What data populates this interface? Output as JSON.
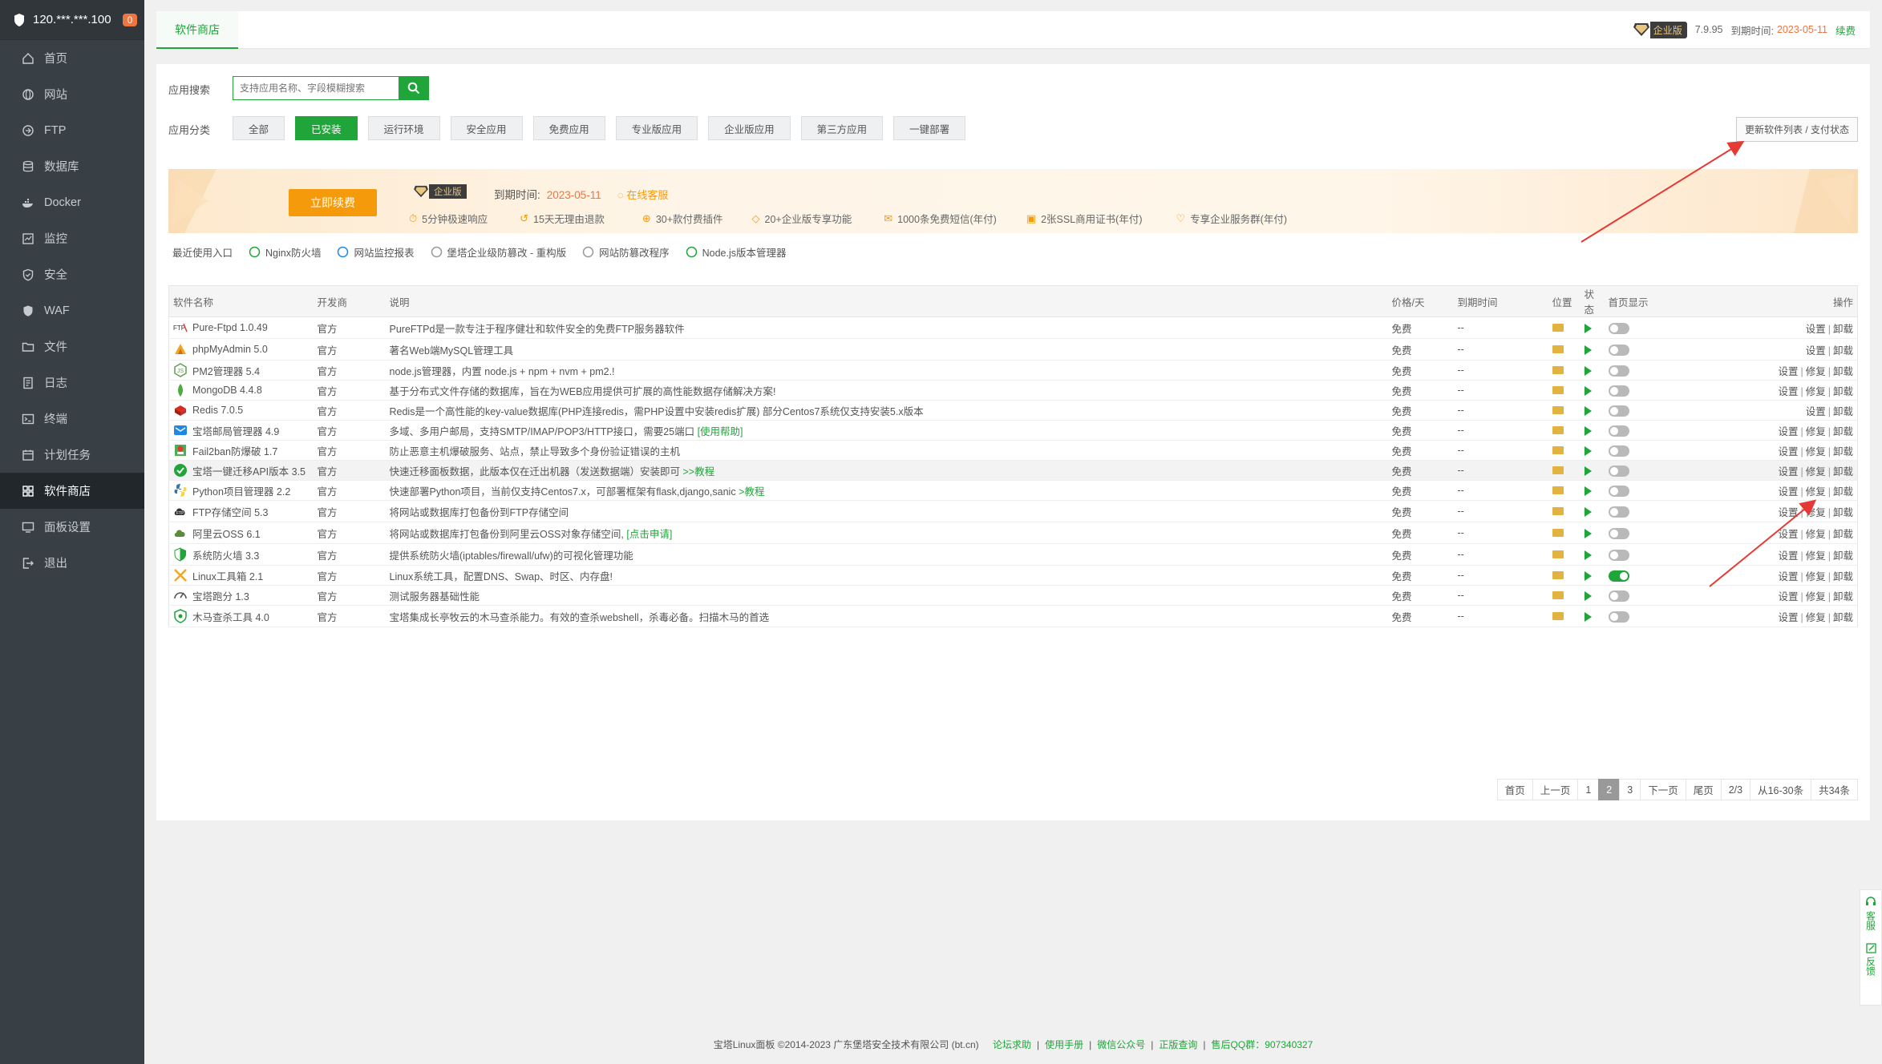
{
  "sidebar": {
    "server_ip": "120.***.***.100",
    "badge_count": "0",
    "items": [
      {
        "label": "首页",
        "icon": "home-icon"
      },
      {
        "label": "网站",
        "icon": "globe-icon"
      },
      {
        "label": "FTP",
        "icon": "ftp-icon"
      },
      {
        "label": "数据库",
        "icon": "database-icon"
      },
      {
        "label": "Docker",
        "icon": "docker-icon"
      },
      {
        "label": "监控",
        "icon": "monitor-icon"
      },
      {
        "label": "安全",
        "icon": "shield-icon"
      },
      {
        "label": "WAF",
        "icon": "waf-icon"
      },
      {
        "label": "文件",
        "icon": "folder-icon"
      },
      {
        "label": "日志",
        "icon": "log-icon"
      },
      {
        "label": "终端",
        "icon": "terminal-icon"
      },
      {
        "label": "计划任务",
        "icon": "calendar-icon"
      },
      {
        "label": "软件商店",
        "icon": "grid-icon",
        "active": true
      },
      {
        "label": "面板设置",
        "icon": "settings-icon"
      },
      {
        "label": "退出",
        "icon": "logout-icon"
      }
    ]
  },
  "topbar": {
    "tab": "软件商店",
    "edition": "企业版",
    "version": "7.9.95",
    "expire_label": "到期时间:",
    "expire_date": "2023-05-11",
    "renew": "续费"
  },
  "search": {
    "label": "应用搜索",
    "placeholder": "支持应用名称、字段模糊搜索"
  },
  "categories": {
    "label": "应用分类",
    "items": [
      "全部",
      "已安装",
      "运行环境",
      "安全应用",
      "免费应用",
      "专业版应用",
      "企业版应用",
      "第三方应用",
      "一键部署"
    ],
    "active_index": 1
  },
  "update_button": "更新软件列表 / 支付状态",
  "banner": {
    "buy_button": "立即续费",
    "edition": "企业版",
    "expire_label": "到期时间:",
    "expire_date": "2023-05-11",
    "online_service": "在线客服",
    "perks": [
      "5分钟极速响应",
      "15天无理由退款",
      "30+款付费插件",
      "20+企业版专享功能",
      "1000条免费短信(年付)",
      "2张SSL商用证书(年付)",
      "专享企业服务群(年付)"
    ]
  },
  "recent": {
    "label": "最近使用入口",
    "items": [
      "Nginx防火墙",
      "网站监控报表",
      "堡塔企业级防篡改 - 重构版",
      "网站防篡改程序",
      "Node.js版本管理器"
    ]
  },
  "table": {
    "headers": [
      "软件名称",
      "开发商",
      "说明",
      "价格/天",
      "到期时间",
      "位置",
      "状态",
      "首页显示",
      "操作"
    ],
    "rows": [
      {
        "name": "Pure-Ftpd 1.0.49",
        "icon": "ftp-logo-icon",
        "dev": "官方",
        "desc": "PureFTPd是一款专注于程序健壮和软件安全的免费FTP服务器软件",
        "price": "免费",
        "expire": "--",
        "home": false,
        "ops": [
          "设置",
          "卸载"
        ]
      },
      {
        "name": "phpMyAdmin 5.0",
        "icon": "phpmyadmin-icon",
        "dev": "官方",
        "desc": "著名Web端MySQL管理工具",
        "price": "免费",
        "expire": "--",
        "home": false,
        "ops": [
          "设置",
          "卸载"
        ]
      },
      {
        "name": "PM2管理器 5.4",
        "icon": "nodejs-icon",
        "dev": "官方",
        "desc": "node.js管理器，内置 node.js + npm + nvm + pm2.!",
        "price": "免费",
        "expire": "--",
        "home": false,
        "ops": [
          "设置",
          "修复",
          "卸载"
        ]
      },
      {
        "name": "MongoDB 4.4.8",
        "icon": "mongodb-icon",
        "dev": "官方",
        "desc": "基于分布式文件存储的数据库，旨在为WEB应用提供可扩展的高性能数据存储解决方案!",
        "price": "免费",
        "expire": "--",
        "home": false,
        "ops": [
          "设置",
          "修复",
          "卸载"
        ]
      },
      {
        "name": "Redis 7.0.5",
        "icon": "redis-icon",
        "dev": "官方",
        "desc": "Redis是一个高性能的key-value数据库(PHP连接redis，需PHP设置中安装redis扩展) 部分Centos7系统仅支持安装5.x版本",
        "price": "免费",
        "expire": "--",
        "home": false,
        "ops": [
          "设置",
          "卸载"
        ]
      },
      {
        "name": "宝塔邮局管理器 4.9",
        "icon": "mail-icon",
        "dev": "官方",
        "desc": "多域、多用户邮局，支持SMTP/IMAP/POP3/HTTP接口，需要25端口",
        "desc_link": "[使用帮助]",
        "price": "免费",
        "expire": "--",
        "home": false,
        "ops": [
          "设置",
          "修复",
          "卸载"
        ]
      },
      {
        "name": "Fail2ban防爆破 1.7",
        "icon": "fail2ban-icon",
        "dev": "官方",
        "desc": "防止恶意主机爆破服务、站点，禁止导致多个身份验证错误的主机",
        "price": "免费",
        "expire": "--",
        "home": false,
        "ops": [
          "设置",
          "修复",
          "卸载"
        ]
      },
      {
        "name": "宝塔一键迁移API版本 3.5",
        "icon": "check-circle-icon",
        "dev": "官方",
        "desc": "快速迁移面板数据，此版本仅在迁出机器（发送数据端）安装即可",
        "desc_link": ">>教程",
        "price": "免费",
        "expire": "--",
        "home": false,
        "ops": [
          "设置",
          "修复",
          "卸载"
        ],
        "highlight": true
      },
      {
        "name": "Python项目管理器 2.2",
        "icon": "python-icon",
        "dev": "官方",
        "desc": "快速部署Python项目，当前仅支持Centos7.x，可部署框架有flask,django,sanic",
        "desc_link": ">教程",
        "price": "免费",
        "expire": "--",
        "home": false,
        "ops": [
          "设置",
          "修复",
          "卸载"
        ]
      },
      {
        "name": "FTP存储空间 5.3",
        "icon": "ftp-cloud-icon",
        "dev": "官方",
        "desc": "将网站或数据库打包备份到FTP存储空间",
        "price": "免费",
        "expire": "--",
        "home": false,
        "ops": [
          "设置",
          "修复",
          "卸载"
        ]
      },
      {
        "name": "阿里云OSS 6.1",
        "icon": "oss-icon",
        "dev": "官方",
        "desc": "将网站或数据库打包备份到阿里云OSS对象存储空间,",
        "desc_link": "[点击申请]",
        "price": "免费",
        "expire": "--",
        "home": false,
        "ops": [
          "设置",
          "修复",
          "卸载"
        ]
      },
      {
        "name": "系统防火墙 3.3",
        "icon": "firewall-icon",
        "dev": "官方",
        "desc": "提供系统防火墙(iptables/firewall/ufw)的可视化管理功能",
        "price": "免费",
        "expire": "--",
        "home": false,
        "ops": [
          "设置",
          "修复",
          "卸载"
        ]
      },
      {
        "name": "Linux工具箱 2.1",
        "icon": "tools-icon",
        "dev": "官方",
        "desc": "Linux系统工具，配置DNS、Swap、时区、内存盘!",
        "price": "免费",
        "expire": "--",
        "home": true,
        "ops": [
          "设置",
          "修复",
          "卸载"
        ]
      },
      {
        "name": "宝塔跑分 1.3",
        "icon": "gauge-icon",
        "dev": "官方",
        "desc": "测试服务器基础性能",
        "price": "免费",
        "expire": "--",
        "home": false,
        "ops": [
          "设置",
          "修复",
          "卸载"
        ]
      },
      {
        "name": "木马查杀工具 4.0",
        "icon": "trojan-shield-icon",
        "dev": "官方",
        "desc": "宝塔集成长亭牧云的木马查杀能力。有效的查杀webshell，杀毒必备。扫描木马的首选",
        "price": "免费",
        "expire": "--",
        "home": false,
        "ops": [
          "设置",
          "修复",
          "卸载"
        ]
      }
    ]
  },
  "pager": {
    "items": [
      "首页",
      "上一页",
      "1",
      "2",
      "3",
      "下一页",
      "尾页",
      "2/3",
      "从16-30条",
      "共34条"
    ],
    "current": "2"
  },
  "footer": {
    "copyright": "宝塔Linux面板 ©2014-2023 广东堡塔安全技术有限公司 (bt.cn)",
    "links": [
      "论坛求助",
      "使用手册",
      "微信公众号",
      "正版查询",
      "售后QQ群：907340327"
    ]
  },
  "float": {
    "items": [
      "客服",
      "反馈"
    ]
  },
  "colors": {
    "accent": "#20a53a",
    "orange": "#f59a0b",
    "sidebar_bg": "#394045"
  }
}
